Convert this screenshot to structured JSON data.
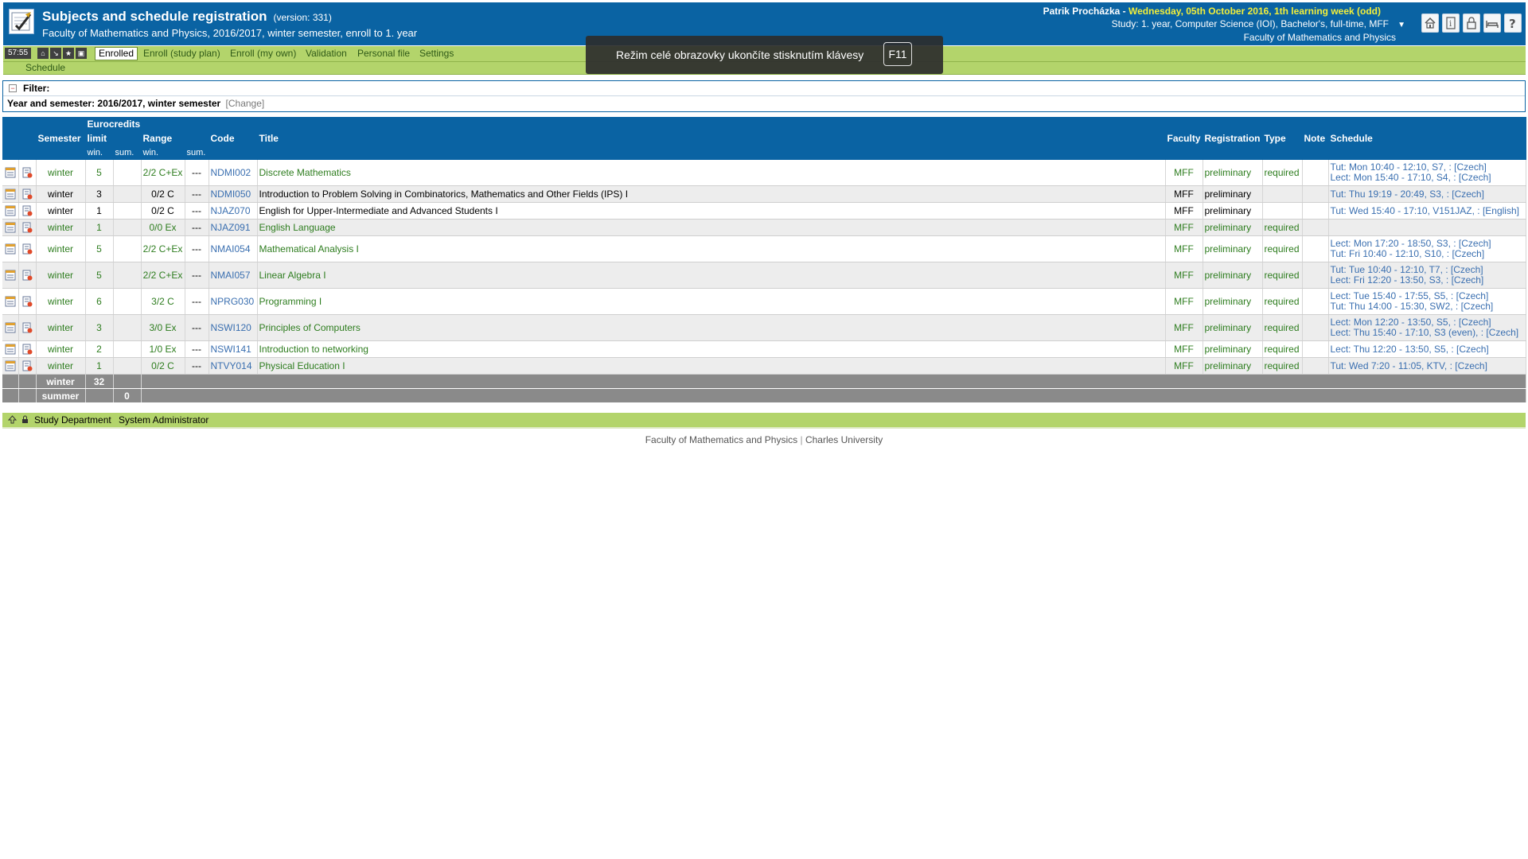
{
  "header": {
    "title": "Subjects and schedule registration",
    "version": "(version: 331)",
    "subtitle": "Faculty of Mathematics and Physics, 2016/2017, winter semester, enroll to 1. year",
    "user": "Patrik Procházka",
    "user_sep": " - ",
    "date": "Wednesday, 05th October 2016, 1th learning week (odd)",
    "study": "Study: 1. year, Computer Science (IOI), Bachelor's, full-time, MFF",
    "faculty": "Faculty of Mathematics and Physics",
    "icons": [
      "home-icon",
      "info-icon",
      "lock-icon",
      "bed-icon",
      "help-icon"
    ]
  },
  "nav": {
    "timer": "57:55",
    "tabs": [
      "Enrolled",
      "Enroll (study plan)",
      "Enroll (my own)",
      "Validation",
      "Personal file",
      "Settings"
    ],
    "active_tab": "Enrolled",
    "subnav": "Schedule"
  },
  "toast": {
    "text": "Režim celé obrazovky ukončíte stisknutím klávesy",
    "key": "F11"
  },
  "filter": {
    "label": "Filter:",
    "row": "Year and semester: 2016/2017, winter semester",
    "change": "[Change]"
  },
  "table": {
    "headers": {
      "semester": "Semester",
      "eurocredits": "Eurocredits",
      "limit": "limit",
      "range": "Range",
      "code": "Code",
      "title": "Title",
      "faculty": "Faculty",
      "registration": "Registration",
      "type": "Type",
      "note": "Note",
      "schedule": "Schedule",
      "win1": "win.",
      "sum1": "sum.",
      "win2": "win.",
      "sum2": "sum."
    },
    "rows": [
      {
        "semester": "winter",
        "credits": "5",
        "range": "2/2 C+Ex",
        "sum": "---",
        "code": "NDMI002",
        "title": "Discrete Mathematics",
        "faculty": "MFF",
        "registration": "preliminary",
        "type": "required",
        "note": "",
        "schedule": [
          "Tut: Mon 10:40 - 12:10, S7, : [Czech]",
          "Lect: Mon 15:40 - 17:10, S4, : [Czech]"
        ],
        "green": true
      },
      {
        "semester": "winter",
        "credits": "3",
        "range": "0/2 C",
        "sum": "---",
        "code": "NDMI050",
        "title": "Introduction to Problem Solving in Combinatorics, Mathematics and Other Fields (IPS) I",
        "faculty": "MFF",
        "registration": "preliminary",
        "type": "",
        "note": "",
        "schedule": [
          "Tut: Thu 19:19 - 20:49, S3, : [Czech]"
        ],
        "green": false
      },
      {
        "semester": "winter",
        "credits": "1",
        "range": "0/2 C",
        "sum": "---",
        "code": "NJAZ070",
        "title": "English for Upper-Intermediate and Advanced Students I",
        "faculty": "MFF",
        "registration": "preliminary",
        "type": "",
        "note": "",
        "schedule": [
          "Tut: Wed 15:40 - 17:10, V151JAZ, : [English]"
        ],
        "green": false
      },
      {
        "semester": "winter",
        "credits": "1",
        "range": "0/0 Ex",
        "sum": "---",
        "code": "NJAZ091",
        "title": "English Language",
        "faculty": "MFF",
        "registration": "preliminary",
        "type": "required",
        "note": "",
        "schedule": [],
        "green": true
      },
      {
        "semester": "winter",
        "credits": "5",
        "range": "2/2 C+Ex",
        "sum": "---",
        "code": "NMAI054",
        "title": "Mathematical Analysis I",
        "faculty": "MFF",
        "registration": "preliminary",
        "type": "required",
        "note": "",
        "schedule": [
          "Lect: Mon 17:20 - 18:50, S3, : [Czech]",
          "Tut: Fri 10:40 - 12:10, S10, : [Czech]"
        ],
        "green": true
      },
      {
        "semester": "winter",
        "credits": "5",
        "range": "2/2 C+Ex",
        "sum": "---",
        "code": "NMAI057",
        "title": "Linear Algebra I",
        "faculty": "MFF",
        "registration": "preliminary",
        "type": "required",
        "note": "",
        "schedule": [
          "Tut: Tue 10:40 - 12:10, T7, : [Czech]",
          "Lect: Fri 12:20 - 13:50, S3, : [Czech]"
        ],
        "green": true
      },
      {
        "semester": "winter",
        "credits": "6",
        "range": "3/2 C",
        "sum": "---",
        "code": "NPRG030",
        "title": "Programming I",
        "faculty": "MFF",
        "registration": "preliminary",
        "type": "required",
        "note": "",
        "schedule": [
          "Lect: Tue 15:40 - 17:55, S5, : [Czech]",
          "Tut: Thu 14:00 - 15:30, SW2, : [Czech]"
        ],
        "green": true
      },
      {
        "semester": "winter",
        "credits": "3",
        "range": "3/0 Ex",
        "sum": "---",
        "code": "NSWI120",
        "title": "Principles of Computers",
        "faculty": "MFF",
        "registration": "preliminary",
        "type": "required",
        "note": "",
        "schedule": [
          "Lect: Mon 12:20 - 13:50, S5, : [Czech]",
          "Lect: Thu 15:40 - 17:10, S3 (even), : [Czech]"
        ],
        "green": true
      },
      {
        "semester": "winter",
        "credits": "2",
        "range": "1/0 Ex",
        "sum": "---",
        "code": "NSWI141",
        "title": "Introduction to networking",
        "faculty": "MFF",
        "registration": "preliminary",
        "type": "required",
        "note": "",
        "schedule": [
          "Lect: Thu 12:20 - 13:50, S5, : [Czech]"
        ],
        "green": true
      },
      {
        "semester": "winter",
        "credits": "1",
        "range": "0/2 C",
        "sum": "---",
        "code": "NTVY014",
        "title": "Physical Education I",
        "faculty": "MFF",
        "registration": "preliminary",
        "type": "required",
        "note": "",
        "schedule": [
          "Tut: Wed 7:20 - 11:05, KTV, : [Czech]"
        ],
        "green": true
      }
    ],
    "summary": [
      {
        "label": "winter",
        "win": "32",
        "sum": ""
      },
      {
        "label": "summer",
        "win": "",
        "sum": "0"
      }
    ]
  },
  "footer": {
    "links": [
      "Study Department",
      "System Administrator"
    ],
    "copyright_left": "Faculty of Mathematics and Physics",
    "copyright_sep": "|",
    "copyright_right": "Charles University"
  }
}
